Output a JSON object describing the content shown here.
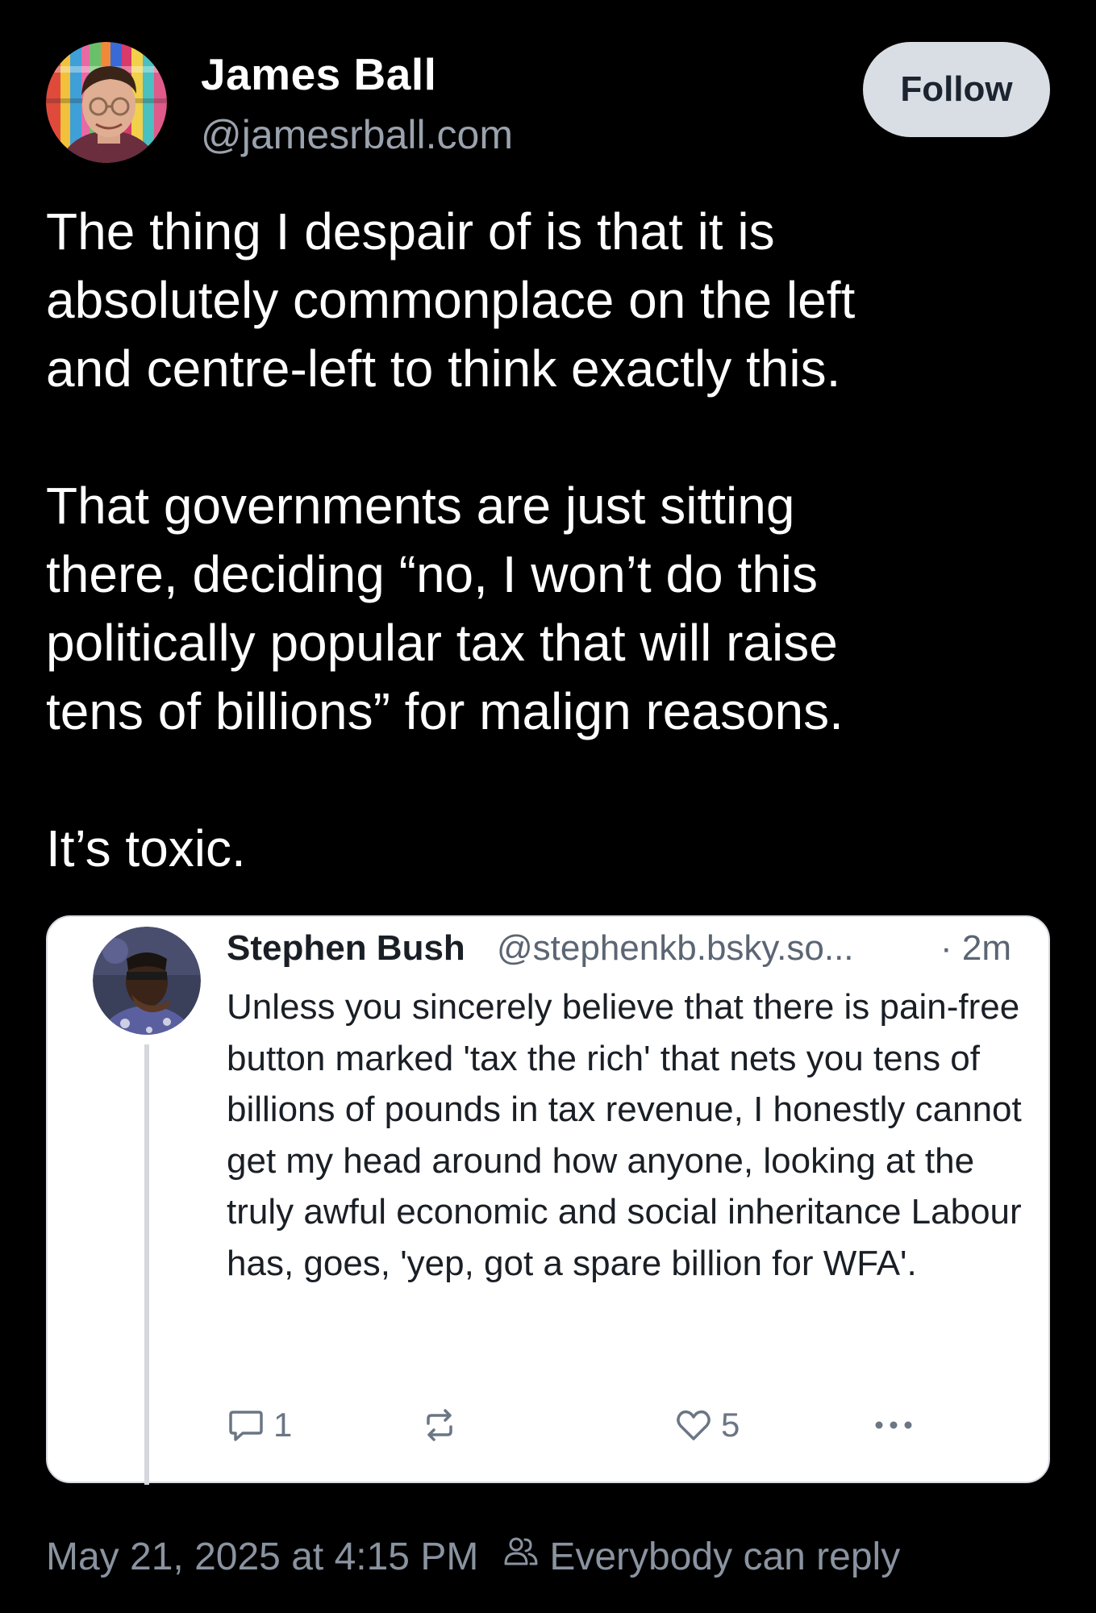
{
  "author": {
    "name": "James Ball",
    "handle": "@jamesrball.com"
  },
  "follow_button": {
    "label": "Follow"
  },
  "post": {
    "paragraphs": [
      "The thing I despair of is that it is\nabsolutely commonplace on the left\nand centre-left to think exactly this.",
      "That governments are just sitting\nthere, deciding “no, I won’t do this\npolitically popular tax that will raise\ntens of billions” for malign reasons.",
      "It’s toxic."
    ]
  },
  "quote": {
    "author_name": "Stephen Bush",
    "author_handle": "@stephenkb.bsky.so...",
    "time": "· 2m",
    "text": "Unless you sincerely believe that there is pain-free button marked 'tax the rich' that nets you tens of billions of pounds in tax revenue, I honestly cannot get my head around how anyone, looking at the truly awful economic and social inheritance Labour has, goes, 'yep, got a spare billion for WFA'.",
    "actions": {
      "reply_count": "1",
      "like_count": "5"
    }
  },
  "footer": {
    "timestamp": "May 21, 2025 at 4:15 PM",
    "reply_setting": "Everybody can reply"
  },
  "icons": {
    "reply": "speech-bubble-icon",
    "repost": "repost-arrows-icon",
    "like": "heart-icon",
    "more": "more-dots-icon",
    "people": "people-icon"
  },
  "colors": {
    "background": "#000000",
    "follow_button_bg": "#d9dee5",
    "muted_text": "#8a93a0",
    "card_bg": "#ffffff"
  }
}
